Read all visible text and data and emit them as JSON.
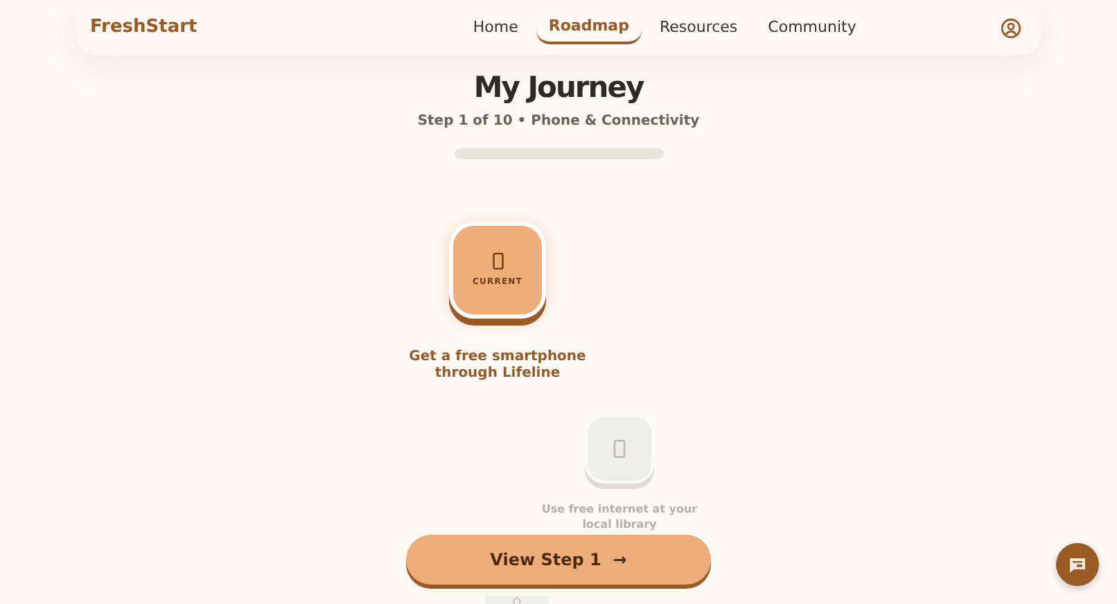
{
  "brand": "FreshStart",
  "nav": [
    {
      "label": "Home",
      "selected": false
    },
    {
      "label": "Roadmap",
      "selected": true
    },
    {
      "label": "Resources",
      "selected": false
    },
    {
      "label": "Community",
      "selected": false
    }
  ],
  "title": "My Journey",
  "subtitle": "Step 1 of 10 • Phone & Connectivity",
  "steps": [
    {
      "kind": "current",
      "badge": "CURRENT",
      "label": "Get a free smartphone through Lifeline"
    },
    {
      "kind": "locked",
      "label": "Use free internet at your local library"
    },
    {
      "kind": "locked"
    }
  ],
  "action": {
    "label": "View Step 1",
    "arrow": "→"
  }
}
